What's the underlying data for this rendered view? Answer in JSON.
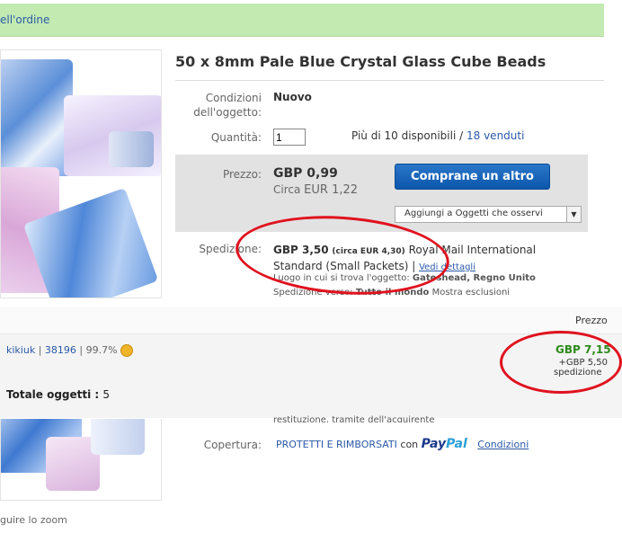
{
  "banner": {
    "text": "ell'ordine"
  },
  "product": {
    "title": "50 x 8mm Pale Blue Crystal Glass Cube Beads"
  },
  "condition": {
    "label": "Condizioni dell'oggetto:",
    "value": "Nuovo"
  },
  "quantity": {
    "label": "Quantità:",
    "value": "1",
    "availability": "Più di 10 disponibili",
    "separator": "/",
    "sold_link": "18 venduti"
  },
  "price": {
    "label": "Prezzo:",
    "value": "GBP 0,99",
    "approx_prefix": "Circa",
    "approx_value": "EUR 1,22"
  },
  "buttons": {
    "buy_again": "Comprane un altro",
    "watchlist": "Aggiungi a Oggetti che osservi"
  },
  "shipping": {
    "label": "Spedizione:",
    "cost": "GBP 3,50",
    "approx": "(circa EUR 4,30)",
    "service_line1": "Royal Mail International",
    "service_line2": "Standard (Small Packets)",
    "details_link": "Vedi dettagli",
    "location_label": "Luogo in cui si trova l'oggetto:",
    "location_value": "Gateshead, Regno Unito",
    "ships_to_label": "Spedizione verso:",
    "ships_to_value": "Tutto il mondo",
    "exclusions_link": "Mostra esclusioni"
  },
  "seller_strip": {
    "price_header": "Prezzo",
    "seller_name": "kikiuk",
    "feedback_count": "38196",
    "feedback_pct": "99.7%",
    "total_price": "GBP 7,15",
    "shipping_extra": "+GBP 5,50",
    "shipping_word": "spedizione",
    "total_items_label": "Totale oggetti :",
    "total_items_value": "5"
  },
  "coverage": {
    "label": "Copertura:",
    "protect_text": "PROTETTI E RIMBORSATI",
    "con": "con",
    "paypal_pay": "Pay",
    "paypal_pal": "Pal",
    "conditions_link": "Condizioni",
    "partial_text": "restituzione, tramite dell'acquirente"
  },
  "photo": {
    "zoom_hint": "guire lo zoom"
  },
  "colors": {
    "accent_blue": "#0c57ab",
    "annotation_red": "#e0121e",
    "price_green": "#2d8a1b",
    "banner_green": "#c2eab1"
  }
}
